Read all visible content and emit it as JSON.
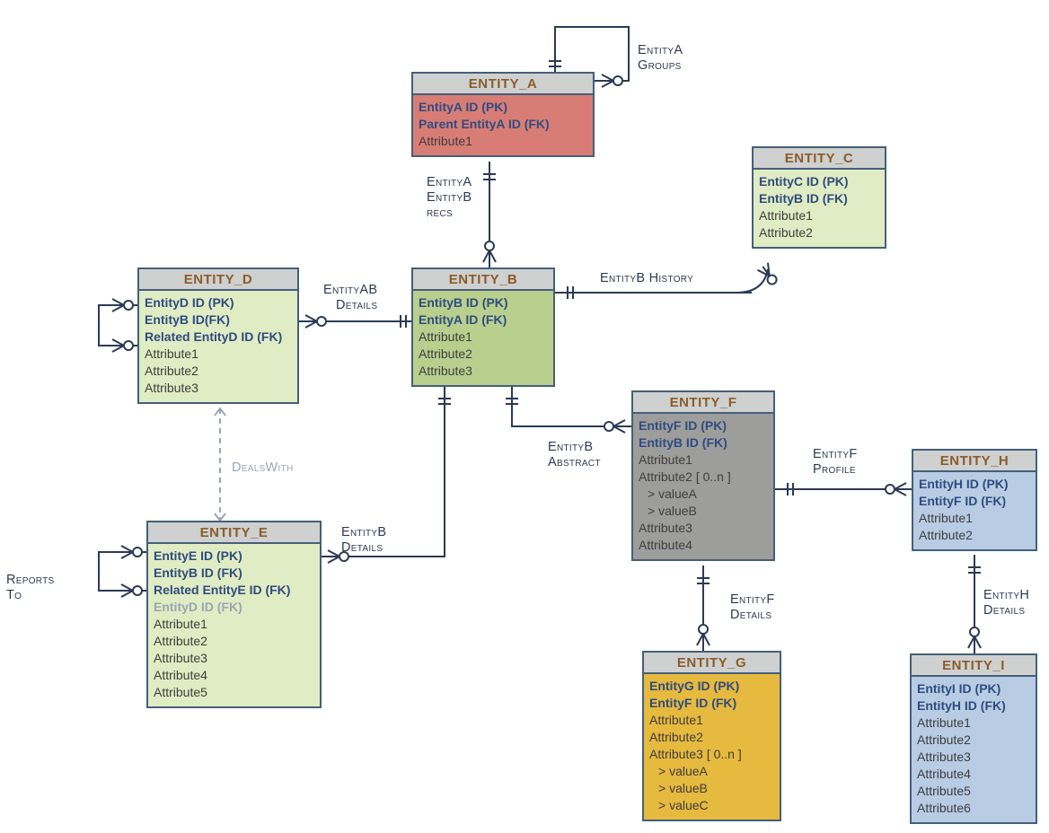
{
  "entities": {
    "A": {
      "title": "ENTITY_A",
      "rows": [
        {
          "t": "EntityA ID (PK)",
          "cls": "fk"
        },
        {
          "t": "Parent EntityA ID (FK)",
          "cls": "fk"
        },
        {
          "t": "Attribute1",
          "cls": "attr"
        }
      ]
    },
    "B": {
      "title": "ENTITY_B",
      "rows": [
        {
          "t": "EntityB ID (PK)",
          "cls": "fk"
        },
        {
          "t": "EntityA ID (FK)",
          "cls": "fk"
        },
        {
          "t": "Attribute1",
          "cls": "attr"
        },
        {
          "t": "Attribute2",
          "cls": "attr"
        },
        {
          "t": "Attribute3",
          "cls": "attr"
        }
      ]
    },
    "C": {
      "title": "ENTITY_C",
      "rows": [
        {
          "t": "EntityC ID (PK)",
          "cls": "fk"
        },
        {
          "t": "EntityB ID (FK)",
          "cls": "fk"
        },
        {
          "t": "Attribute1",
          "cls": "attr"
        },
        {
          "t": "Attribute2",
          "cls": "attr"
        }
      ]
    },
    "D": {
      "title": "ENTITY_D",
      "rows": [
        {
          "t": "EntityD ID (PK)",
          "cls": "fk"
        },
        {
          "t": "EntityB ID(FK)",
          "cls": "fk"
        },
        {
          "t": "Related EntityD ID (FK)",
          "cls": "fk"
        },
        {
          "t": "Attribute1",
          "cls": "attr"
        },
        {
          "t": "Attribute2",
          "cls": "attr"
        },
        {
          "t": "Attribute3",
          "cls": "attr"
        }
      ]
    },
    "E": {
      "title": "ENTITY_E",
      "rows": [
        {
          "t": "EntityE ID (PK)",
          "cls": "fk"
        },
        {
          "t": "EntityB ID (FK)",
          "cls": "fk"
        },
        {
          "t": "Related EntityE ID (FK)",
          "cls": "fk"
        },
        {
          "t": "EntityD ID (FK)",
          "cls": "fk-muted"
        },
        {
          "t": "Attribute1",
          "cls": "attr"
        },
        {
          "t": "Attribute2",
          "cls": "attr"
        },
        {
          "t": "Attribute3",
          "cls": "attr"
        },
        {
          "t": "Attribute4",
          "cls": "attr"
        },
        {
          "t": "Attribute5",
          "cls": "attr"
        }
      ]
    },
    "F": {
      "title": "ENTITY_F",
      "rows": [
        {
          "t": "EntityF ID (PK)",
          "cls": "fk"
        },
        {
          "t": "EntityB ID (FK)",
          "cls": "fk"
        },
        {
          "t": "Attribute1",
          "cls": "attr"
        },
        {
          "t": "Attribute2 [ 0..n ]",
          "cls": "attr"
        },
        {
          "t": "> valueA",
          "cls": "sub"
        },
        {
          "t": "> valueB",
          "cls": "sub"
        },
        {
          "t": "Attribute3",
          "cls": "attr"
        },
        {
          "t": "Attribute4",
          "cls": "attr"
        }
      ]
    },
    "G": {
      "title": "ENTITY_G",
      "rows": [
        {
          "t": "EntityG ID (PK)",
          "cls": "fk"
        },
        {
          "t": "EntityF ID (FK)",
          "cls": "fk"
        },
        {
          "t": "Attribute1",
          "cls": "attr"
        },
        {
          "t": "Attribute2",
          "cls": "attr"
        },
        {
          "t": "Attribute3 [ 0..n ]",
          "cls": "attr"
        },
        {
          "t": "> valueA",
          "cls": "sub"
        },
        {
          "t": "> valueB",
          "cls": "sub"
        },
        {
          "t": "> valueC",
          "cls": "sub"
        }
      ]
    },
    "H": {
      "title": "ENTITY_H",
      "rows": [
        {
          "t": "EntityH ID (PK)",
          "cls": "fk"
        },
        {
          "t": "EntityF ID (FK)",
          "cls": "fk"
        },
        {
          "t": "Attribute1",
          "cls": "attr"
        },
        {
          "t": "Attribute2",
          "cls": "attr"
        }
      ]
    },
    "I": {
      "title": "ENTITY_I",
      "rows": [
        {
          "t": "EntityI ID (PK)",
          "cls": "fk"
        },
        {
          "t": "EntityH  ID (FK)",
          "cls": "fk"
        },
        {
          "t": "Attribute1",
          "cls": "attr"
        },
        {
          "t": "Attribute2",
          "cls": "attr"
        },
        {
          "t": "Attribute3",
          "cls": "attr"
        },
        {
          "t": "Attribute4",
          "cls": "attr"
        },
        {
          "t": "Attribute5",
          "cls": "attr"
        },
        {
          "t": "Attribute6",
          "cls": "attr"
        }
      ]
    }
  },
  "labels": {
    "a_groups": "EntityA\nGroups",
    "a_b_recs": "EntityA\nEntityB\nrecs",
    "ab_details": "EntityAB\nDetails",
    "b_history": "EntityB History",
    "b_details": "EntityB\nDetails",
    "b_abstract": "EntityB\nAbstract",
    "f_profile": "EntityF\nProfile",
    "f_details": "EntityF\nDetails",
    "h_details": "EntityH\nDetails",
    "reports_to": "Reports\nTo",
    "deals_with": "DealsWith"
  }
}
